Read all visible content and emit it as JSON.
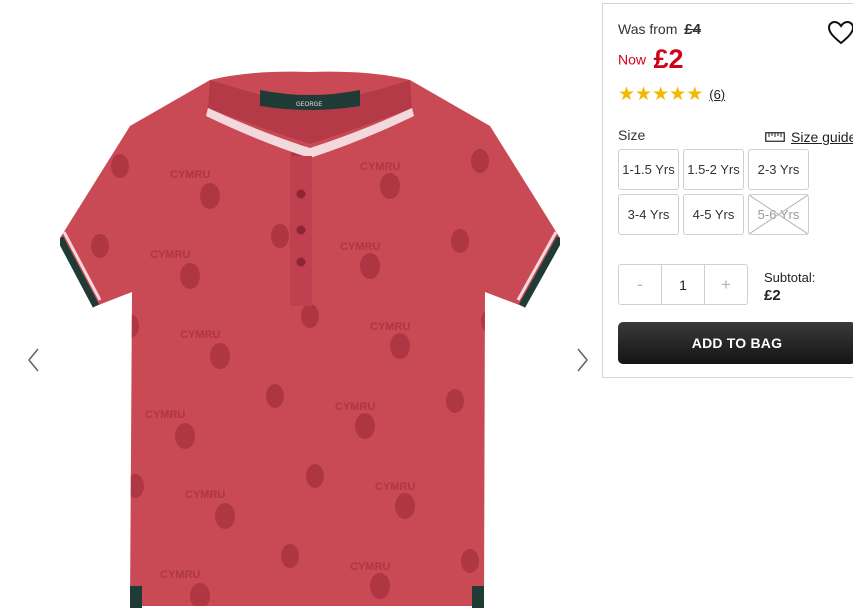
{
  "gallery": {
    "prev_icon": "chevron-left-icon",
    "next_icon": "chevron-right-icon",
    "product_image": {
      "kind": "red polo shirt with dragon print",
      "shirt_color": "#c94a55",
      "collar_color": "#1f3b35",
      "tip_stripe_color": "#f4d9dc",
      "tag_text": "GEORGE",
      "print_text": "CYMRU"
    }
  },
  "pricing": {
    "was_label": "Was from",
    "was_price": "£4",
    "now_label": "Now",
    "now_price": "£2",
    "price_color": "#d0021b"
  },
  "wishlist_icon": "heart-icon",
  "rating": {
    "stars": 5,
    "count_label": "(6)",
    "star_color": "#f5b800"
  },
  "sizes": {
    "label": "Size",
    "guide_label": "Size guide",
    "guide_icon": "ruler-icon",
    "options": [
      {
        "label": "1-1.5 Yrs",
        "available": true
      },
      {
        "label": "1.5-2 Yrs",
        "available": true
      },
      {
        "label": "2-3 Yrs",
        "available": true
      },
      {
        "label": "3-4 Yrs",
        "available": true
      },
      {
        "label": "4-5 Yrs",
        "available": true
      },
      {
        "label": "5-6 Yrs",
        "available": false
      }
    ]
  },
  "quantity": {
    "minus": "-",
    "value": "1",
    "plus": "+"
  },
  "subtotal": {
    "label": "Subtotal:",
    "amount": "£2"
  },
  "add_to_bag_label": "ADD TO BAG"
}
